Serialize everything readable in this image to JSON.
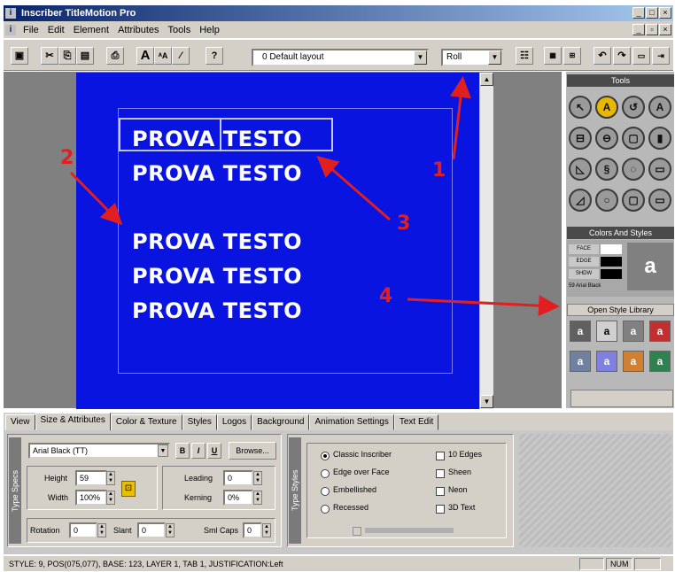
{
  "window": {
    "title": "Inscriber TitleMotion Pro"
  },
  "menu": [
    "File",
    "Edit",
    "Element",
    "Attributes",
    "Tools",
    "Help"
  ],
  "toolbar": {
    "layout_combo": "0 Default layout",
    "roll_combo": "Roll",
    "help_label": "?"
  },
  "canvas": {
    "lines": [
      "PROVA  TESTO",
      "PROVA  TESTO",
      "PROVA  TESTO",
      "PROVA  TESTO",
      "PROVA  TESTO"
    ]
  },
  "annotations": [
    "1",
    "2",
    "3",
    "4"
  ],
  "panels": {
    "tools_title": "Tools",
    "colors_title": "Colors And Styles",
    "face": "FACE",
    "edge": "EDGE",
    "shadow": "SHDW",
    "style_font": "59 Arial Black",
    "open_style_library": "Open Style Library"
  },
  "tabs": [
    "View",
    "Size & Attributes",
    "Color & Texture",
    "Styles",
    "Logos",
    "Background",
    "Animation Settings",
    "Text Edit"
  ],
  "type_specs": {
    "group_label": "Type Specs",
    "font": "Arial Black (TT)",
    "bold": "B",
    "italic": "I",
    "underline": "U",
    "browse": "Browse...",
    "height_label": "Height",
    "height_value": "59",
    "width_label": "Width",
    "width_value": "100%",
    "leading_label": "Leading",
    "leading_value": "0",
    "kerning_label": "Kerning",
    "kerning_value": "0%",
    "rotation_label": "Rotation",
    "rotation_value": "0",
    "slant_label": "Slant",
    "slant_value": "0",
    "smallcaps_label": "Sml Caps",
    "smallcaps_value": "0"
  },
  "type_styles": {
    "group_label": "Type Styles",
    "options": [
      {
        "label": "Classic Inscriber",
        "checked": true
      },
      {
        "label": "Edge over Face",
        "checked": false
      },
      {
        "label": "Embellished",
        "checked": false
      },
      {
        "label": "Recessed",
        "checked": false
      }
    ],
    "checks": [
      {
        "label": "10 Edges"
      },
      {
        "label": "Sheen"
      },
      {
        "label": "Neon"
      },
      {
        "label": "3D Text"
      }
    ]
  },
  "statusbar": {
    "text": "STYLE: 9, POS(075,077), BASE: 123, LAYER 1, TAB 1, JUSTIFICATION:Left",
    "num": "NUM"
  }
}
